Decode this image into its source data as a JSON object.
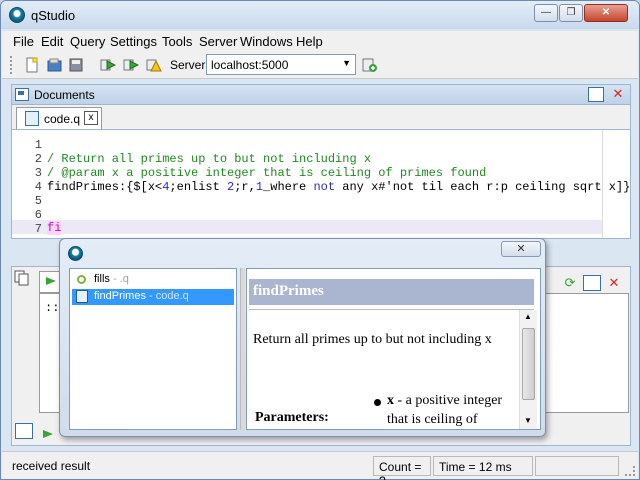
{
  "window": {
    "title": "qStudio",
    "min": "—",
    "max": "❐",
    "close": "✕"
  },
  "menu": [
    "File",
    "Edit",
    "Query",
    "Settings",
    "Tools",
    "Server",
    "Windows",
    "Help"
  ],
  "toolbar": {
    "server_label": "Server:",
    "server_value": "localhost:5000"
  },
  "documents": {
    "title": "Documents",
    "tab_label": "code.q",
    "tab_close": "x"
  },
  "editor": {
    "line_numbers": [
      "1",
      "2",
      "3",
      "4",
      "5",
      "6",
      "7"
    ],
    "comment1": "/ Return all primes up to but not including x",
    "comment2": "/ @param x a positive integer that is ceiling of primes found",
    "code4": {
      "a": "findPrimes:{$[x<",
      "b": "4",
      "c": ";enlist ",
      "d": "2",
      "e": ";r,",
      "f": "1",
      "g": "_where ",
      "h": "not",
      "i": " any x#'not til each r:p ceiling sqrt x]}"
    },
    "line7": "fi"
  },
  "lower_panel": {
    "content": "::"
  },
  "popup": {
    "close": "✕",
    "items": [
      {
        "name": "fills",
        "source": " - .q"
      },
      {
        "name": "findPrimes",
        "source": " - code.q"
      }
    ],
    "doc_title": "findPrimes",
    "doc_description": "Return all primes up to but not including x",
    "params_label": "Parameters:",
    "param_name": "x",
    "param_desc": " - a positive integer that is ceiling of primes found"
  },
  "status": {
    "message": "received result",
    "count": "Count = ?",
    "time": "Time = 12 ms",
    "extra": ""
  },
  "colors": {
    "accent": "#3399ff",
    "comment": "#1f8a1f",
    "number": "#2727d8",
    "close": "#c7452d"
  }
}
